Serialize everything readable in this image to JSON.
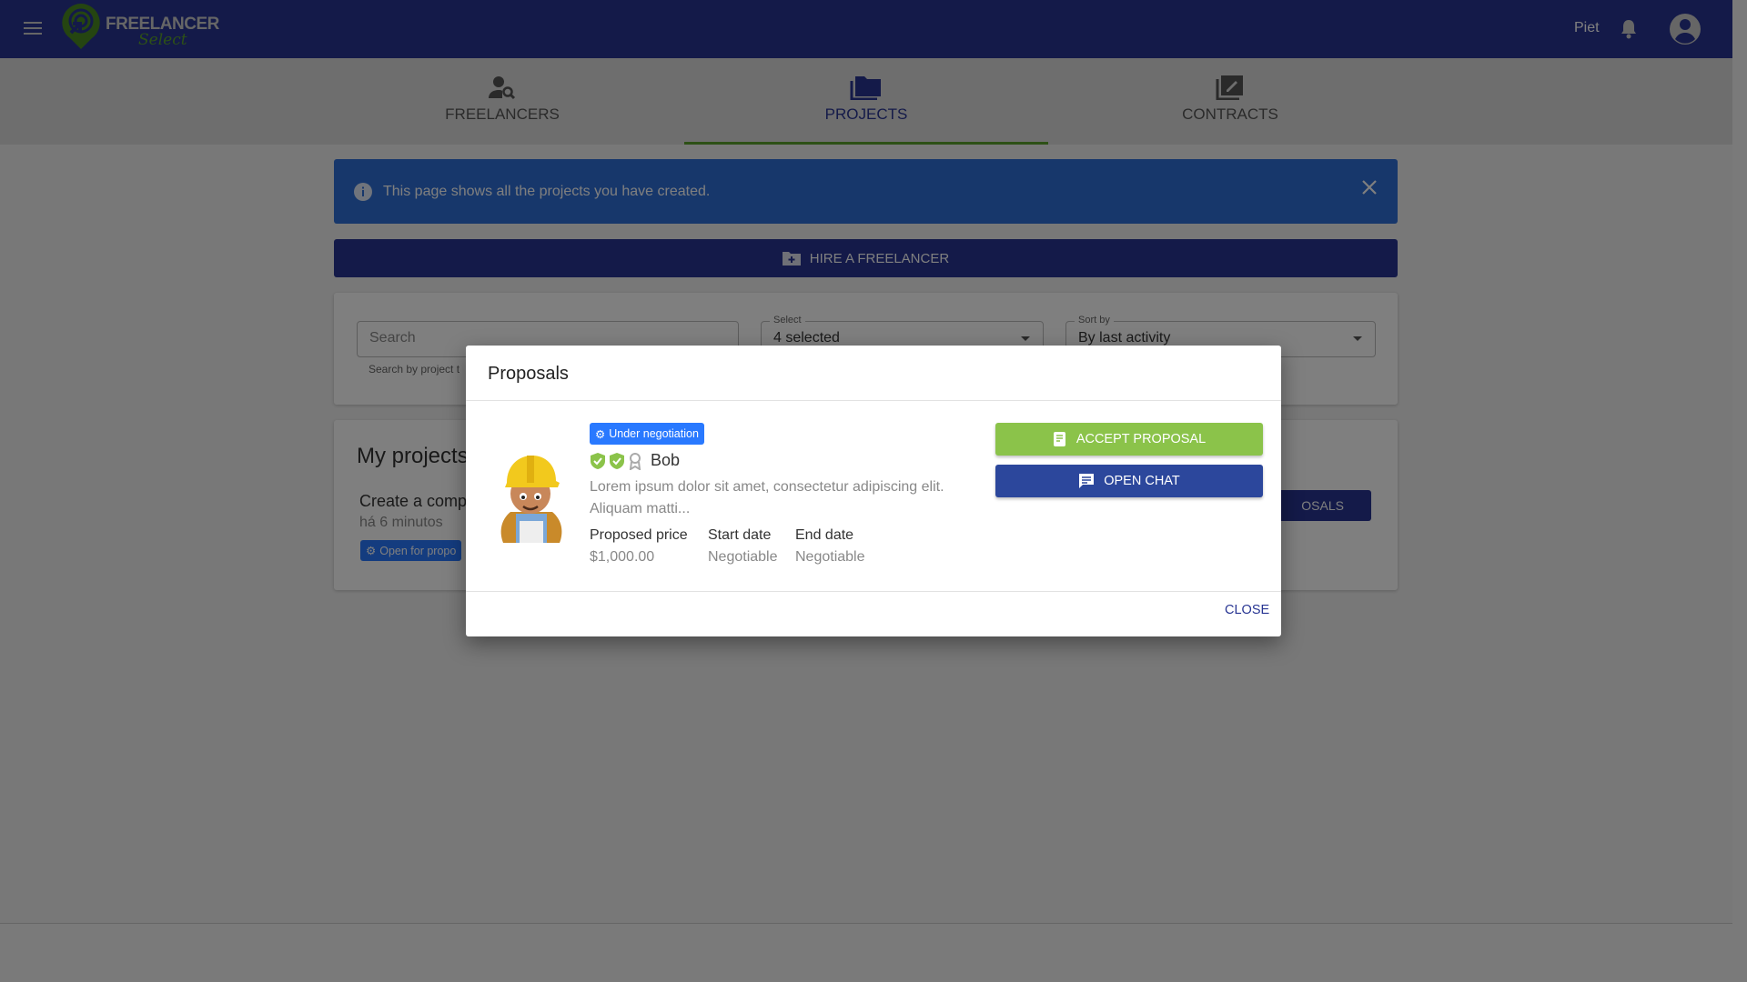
{
  "header": {
    "brand": "FREELANCER",
    "brand_sub": "Select",
    "user": "Piet"
  },
  "tabs": [
    {
      "label": "FREELANCERS",
      "icon": "person-search-icon"
    },
    {
      "label": "PROJECTS",
      "icon": "folder-icon",
      "active": true
    },
    {
      "label": "CONTRACTS",
      "icon": "edit-document-icon"
    }
  ],
  "banner": {
    "text": "This page shows all the projects you have created."
  },
  "hire_button": "HIRE A FREELANCER",
  "filters": {
    "search_placeholder": "Search",
    "search_helper": "Search by project t",
    "select_label": "Select",
    "select_value": "4 selected",
    "sort_label": "Sort by",
    "sort_value": "By last activity"
  },
  "projects": {
    "title": "My projects",
    "item": {
      "title": "Create a comp",
      "time": "há 6 minutos",
      "badge": "Open for propo",
      "button": "OSALS"
    }
  },
  "modal": {
    "title": "Proposals",
    "proposal": {
      "status": "Under negotiation",
      "name": "Bob",
      "description": "Lorem ipsum dolor sit amet, consectetur adipiscing elit.",
      "description2": "Aliquam matti...",
      "price_label": "Proposed price",
      "price": "$1,000.00",
      "start_label": "Start date",
      "start": "Negotiable",
      "end_label": "End date",
      "end": "Negotiable"
    },
    "accept": "ACCEPT PROPOSAL",
    "chat": "OPEN CHAT",
    "close": "CLOSE"
  },
  "colors": {
    "primary": "#283593",
    "accent": "#8bc34a",
    "badge": "#2979ff"
  }
}
